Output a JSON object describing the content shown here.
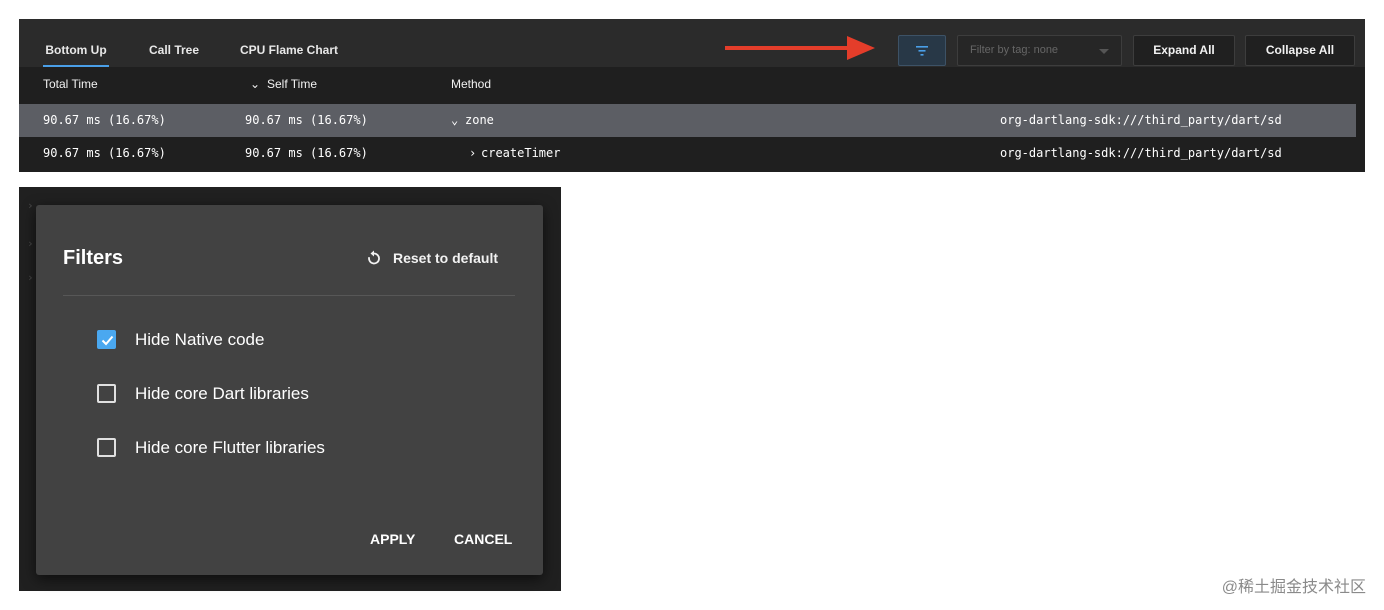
{
  "toolbar": {
    "tabs": [
      {
        "label": "Bottom Up",
        "active": true
      },
      {
        "label": "Call Tree",
        "active": false
      },
      {
        "label": "CPU Flame Chart",
        "active": false
      }
    ],
    "filter_tag": "Filter by tag: none",
    "expand_all": "Expand All",
    "collapse_all": "Collapse All",
    "annotation_arrow_color": "#e43d2a"
  },
  "table": {
    "columns": {
      "total_time": "Total Time",
      "self_time": "Self Time",
      "method": "Method"
    },
    "rows": [
      {
        "total": "90.67 ms (16.67%)",
        "self": "90.67 ms (16.67%)",
        "method": "zone",
        "expander": "⌄",
        "source": "org-dartlang-sdk:///third_party/dart/sd",
        "selected": true
      },
      {
        "total": "90.67 ms (16.67%)",
        "self": "90.67 ms (16.67%)",
        "method": "createTimer",
        "expander": "›",
        "source": "org-dartlang-sdk:///third_party/dart/sd",
        "selected": false
      }
    ]
  },
  "dialog": {
    "title": "Filters",
    "reset_label": "Reset to default",
    "options": [
      {
        "label": "Hide Native code",
        "checked": true
      },
      {
        "label": "Hide core Dart libraries",
        "checked": false
      },
      {
        "label": "Hide core Flutter libraries",
        "checked": false
      }
    ],
    "apply_label": "APPLY",
    "cancel_label": "CANCEL"
  },
  "colors": {
    "accent": "#4a9fe8",
    "checkbox_checked": "#4aa8f0",
    "selected_row": "#5c5e64",
    "dialog_bg": "#424242"
  },
  "watermark": "@稀土掘金技术社区"
}
